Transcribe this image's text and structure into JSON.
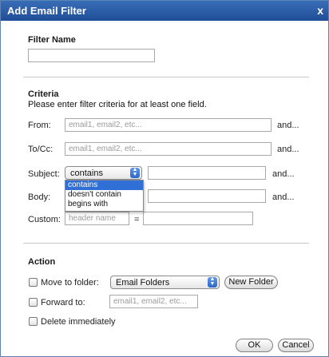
{
  "dialog": {
    "title": "Add Email Filter",
    "close_glyph": "x"
  },
  "filter_name": {
    "heading": "Filter Name",
    "value": ""
  },
  "criteria": {
    "heading": "Criteria",
    "instruction": "Please enter filter criteria for at least one field.",
    "from": {
      "label": "From:",
      "placeholder": "email1, email2, etc...",
      "suffix": "and..."
    },
    "tocc": {
      "label": "To/Cc:",
      "placeholder": "email1, email2, etc...",
      "suffix": "and..."
    },
    "subject": {
      "label": "Subject:",
      "selected": "contains",
      "options": [
        "contains",
        "doesn't contain",
        "begins with"
      ],
      "suffix": "and..."
    },
    "body": {
      "label": "Body:",
      "suffix": "and..."
    },
    "custom": {
      "label": "Custom:",
      "placeholder": "header name",
      "equals": "="
    }
  },
  "action": {
    "heading": "Action",
    "move": {
      "label": "Move to folder:",
      "selected": "Email Folders",
      "new_folder_button": "New Folder"
    },
    "forward": {
      "label": "Forward to:",
      "placeholder": "email1, email2, etc..."
    },
    "delete": {
      "label": "Delete immediately"
    }
  },
  "buttons": {
    "ok": "OK",
    "cancel": "Cancel"
  },
  "colors": {
    "title_bar": "#2a5ca8",
    "selected_option": "#2f6fd6"
  }
}
